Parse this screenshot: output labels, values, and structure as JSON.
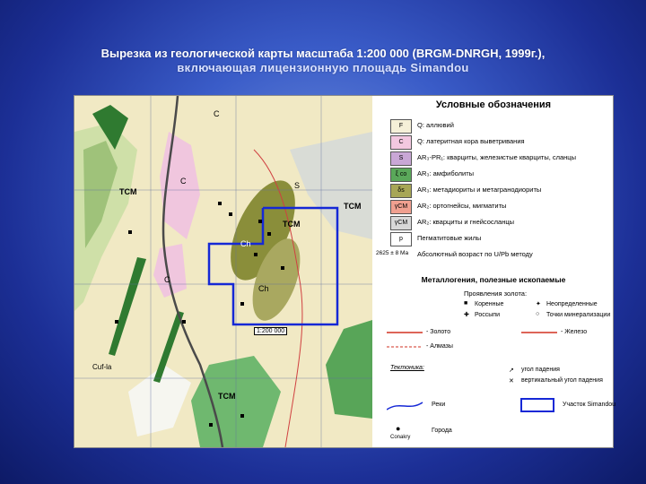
{
  "title": {
    "line1": "Вырезка из геологической карты масштаба 1:200 000 (BRGM-DNRGH, 1999г.),",
    "line2": "включающая лицензионную площадь Simandou"
  },
  "map": {
    "labels": [
      "TCM",
      "TCM",
      "TCM",
      "TCM",
      "C",
      "C",
      "C",
      "S",
      "Ch",
      "Ch",
      "Cuf-la"
    ],
    "scale_label": "1:200 000"
  },
  "legend": {
    "title": "Условные обозначения",
    "units": [
      {
        "code": "F",
        "color": "#f5f0d8",
        "text": "Q: аллювий"
      },
      {
        "code": "C",
        "color": "#f3c8e0",
        "text": "Q: латеритная кора выветривания"
      },
      {
        "code": "S",
        "color": "#c9a7d6",
        "text": "AR₃-PR₁: кварциты, железистые кварциты, сланцы"
      },
      {
        "code": "ξ co",
        "color": "#5aa85a",
        "text": "AR₃: амфиболиты"
      },
      {
        "code": "δs",
        "color": "#a7a656",
        "text": "AR₃: метадиориты и метагранодиориты"
      },
      {
        "code": "γCM",
        "color": "#f0a090",
        "text": "AR₂: ортогнейсы, мигматиты"
      },
      {
        "code": "γCM",
        "color": "#d8d8d8",
        "text": "AR₂: кварциты и гнейсосланцы"
      },
      {
        "code": "p",
        "color": "#ffffff",
        "text": "Пегматитовые жилы"
      },
      {
        "code": "2625 ± 8 Ma",
        "color": "#ffffff",
        "text": "Абсолютный возраст по U/Pb методу"
      }
    ],
    "metallogeny_title": "Металлогения, полезные ископаемые",
    "gold_title": "Проявления золота:",
    "gold_items": [
      "Коренные",
      "Россыпи",
      "Неопределенные",
      "Точки минерализации"
    ],
    "lines": [
      "- Золото",
      "- Железо",
      "- Алмазы"
    ],
    "tectonics": "Тектоника:",
    "dip": "угол падения",
    "vertical": "вертикальный угол падения",
    "rivers": "Реки",
    "area": "Участок Simandou",
    "cities": "Города",
    "city_name": "Conakry"
  },
  "colors": {
    "border_blue": "#1528d6",
    "gold_line": "#d23020",
    "iron_line": "#d23020"
  }
}
